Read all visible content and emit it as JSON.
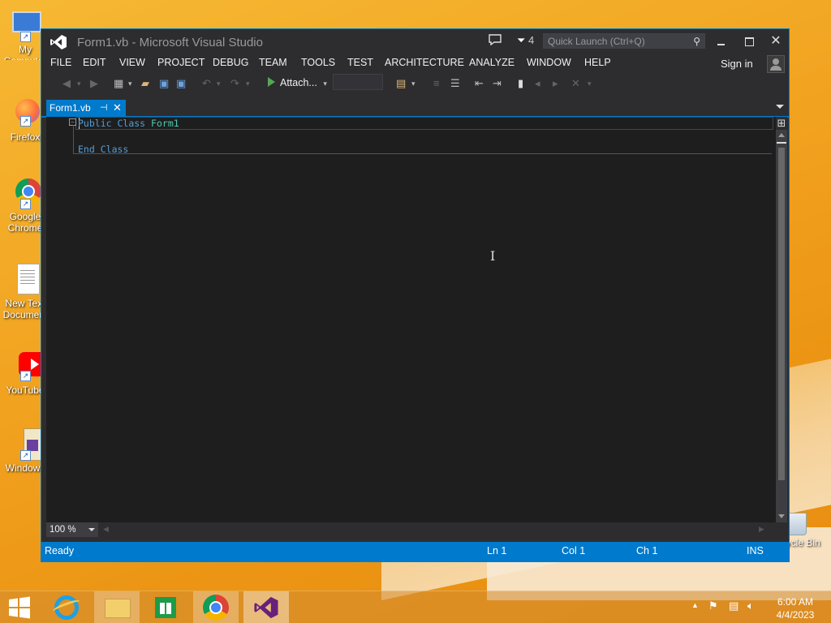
{
  "desktop": {
    "icons": [
      {
        "label": "My Computer",
        "icon": "computer-icon"
      },
      {
        "label": "Firefox",
        "icon": "firefox-icon"
      },
      {
        "label": "Google Chrome",
        "icon": "chrome-icon"
      },
      {
        "label": "New Text Document",
        "icon": "text-document-icon"
      },
      {
        "label": "YouTube",
        "icon": "youtube-icon"
      },
      {
        "label": "Windows",
        "icon": "windows-app-icon"
      }
    ],
    "recycle_bin_label": "Recycle Bin"
  },
  "window": {
    "title": "Form1.vb - Microsoft Visual Studio",
    "notification_count": "4",
    "quick_launch_placeholder": "Quick Launch (Ctrl+Q)",
    "sign_in": "Sign in"
  },
  "menu": [
    "FILE",
    "EDIT",
    "VIEW",
    "PROJECT",
    "DEBUG",
    "TEAM",
    "TOOLS",
    "TEST",
    "ARCHITECTURE",
    "ANALYZE",
    "WINDOW",
    "HELP"
  ],
  "toolbar": {
    "attach_label": "Attach..."
  },
  "editor": {
    "tab_label": "Form1.vb",
    "code": {
      "line1": {
        "kw1": "Public",
        "kw2": "Class",
        "name": "Form1"
      },
      "line3": {
        "kw1": "End",
        "kw2": "Class"
      }
    },
    "zoom": "100 %"
  },
  "status": {
    "state": "Ready",
    "line": "Ln 1",
    "col": "Col 1",
    "ch": "Ch 1",
    "mode": "INS"
  },
  "taskbar": {
    "time": "6:00 AM",
    "date": "4/4/2023"
  }
}
